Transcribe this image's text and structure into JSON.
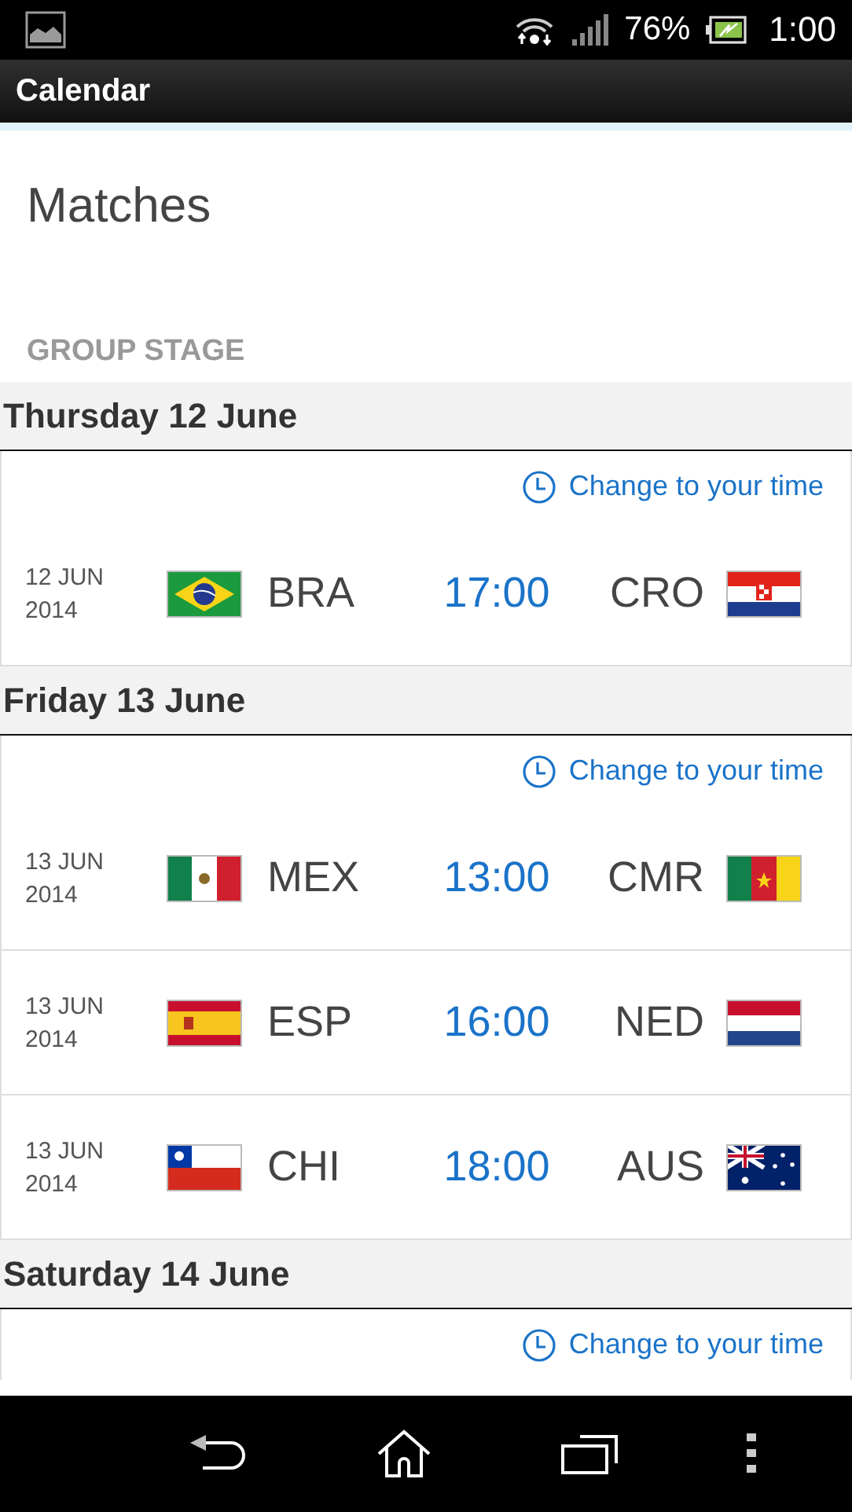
{
  "status_bar": {
    "battery": "76%",
    "time": "1:00"
  },
  "app_bar": {
    "title": "Calendar"
  },
  "page": {
    "title": "Matches",
    "section": "GROUP STAGE"
  },
  "days": [
    {
      "label": "Thursday 12 June",
      "change_time_link": "Change to your time",
      "matches": [
        {
          "date": "12 JUN",
          "year": "2014",
          "home": {
            "code": "BRA",
            "kind": "brazil"
          },
          "time": "17:00",
          "away": {
            "code": "CRO",
            "kind": "croatia"
          }
        }
      ]
    },
    {
      "label": "Friday 13 June",
      "change_time_link": "Change to your time",
      "matches": [
        {
          "date": "13 JUN",
          "year": "2014",
          "home": {
            "code": "MEX",
            "kind": "mexico"
          },
          "time": "13:00",
          "away": {
            "code": "CMR",
            "kind": "cameroon"
          }
        },
        {
          "date": "13 JUN",
          "year": "2014",
          "home": {
            "code": "ESP",
            "kind": "spain"
          },
          "time": "16:00",
          "away": {
            "code": "NED",
            "kind": "netherlands"
          }
        },
        {
          "date": "13 JUN",
          "year": "2014",
          "home": {
            "code": "CHI",
            "kind": "chile"
          },
          "time": "18:00",
          "away": {
            "code": "AUS",
            "kind": "australia"
          }
        }
      ]
    },
    {
      "label": "Saturday 14 June",
      "change_time_link": "Change to your time"
    }
  ]
}
